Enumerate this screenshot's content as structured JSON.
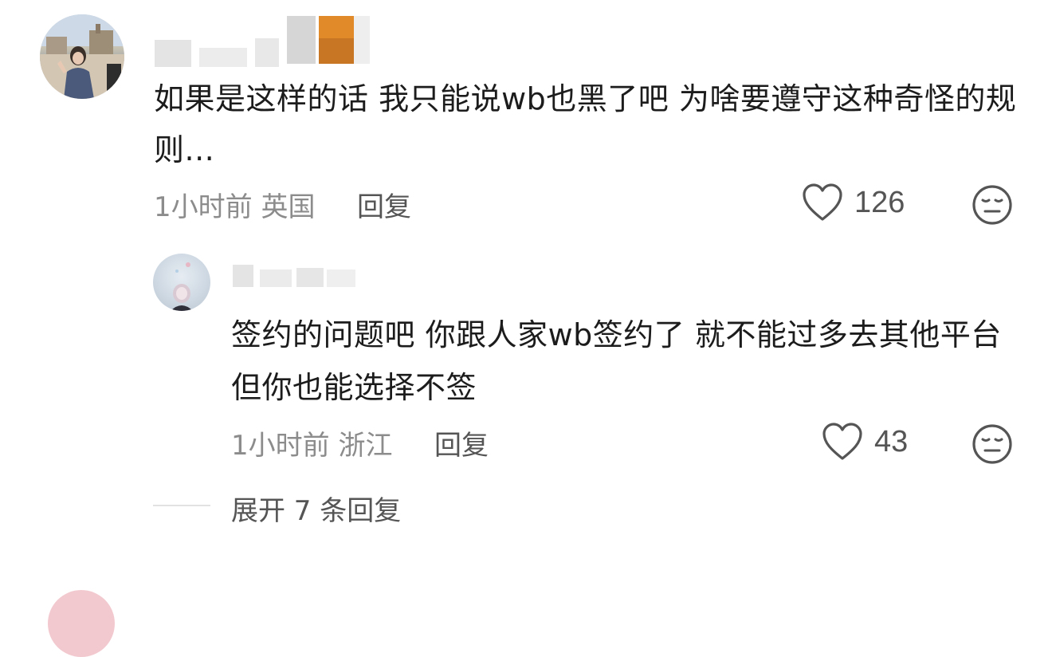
{
  "comment": {
    "body": "如果是这样的话 我只能说wb也黑了吧      为啥要遵守这种奇怪的规则...",
    "time": "1小时前",
    "location": "英国",
    "reply_label": "回复",
    "likes": "126",
    "like_icon": "heart-outline-icon",
    "dislike_icon": "meh-face-icon"
  },
  "reply": {
    "body": "签约的问题吧  你跟人家wb签约了 就不能过多去其他平台 但你也能选择不签",
    "time": "1小时前",
    "location": "浙江",
    "reply_label": "回复",
    "likes": "43",
    "like_icon": "heart-outline-icon",
    "dislike_icon": "meh-face-icon"
  },
  "expand": {
    "label": "展开 7 条回复"
  },
  "colors": {
    "text": "#1c1c1c",
    "meta": "#8c8c8c",
    "secondary": "#555555",
    "divider": "#e2e2e2"
  }
}
